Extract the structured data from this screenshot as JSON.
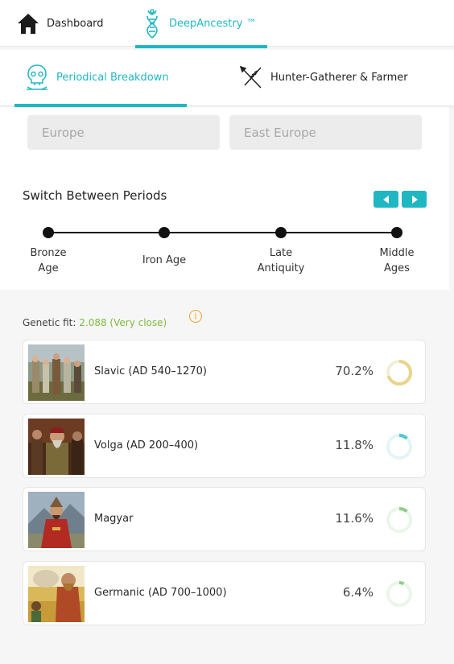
{
  "nav": {
    "dashboard": "Dashboard",
    "deep_ancestry": "DeepAncestry ™"
  },
  "subnav": {
    "periodical": "Periodical Breakdown",
    "hunter": "Hunter-Gatherer & Farmer"
  },
  "filters": {
    "region": "Europe",
    "subregion": "East Europe"
  },
  "periods": {
    "title": "Switch Between Periods",
    "labels": [
      "Bronze Age",
      "Iron Age",
      "Late Antiquity",
      "Middle Ages"
    ]
  },
  "fit": {
    "label": "Genetic fit:",
    "value": "2.088 (Very close)",
    "info_icon": "info-icon"
  },
  "results": [
    {
      "name": "Slavic (AD 540–1270)",
      "percent": "70.2%",
      "fraction": 0.702,
      "color": "#e9d48a"
    },
    {
      "name": "Volga (AD 200–400)",
      "percent": "11.8%",
      "fraction": 0.118,
      "color": "#4ec8d8"
    },
    {
      "name": "Magyar",
      "percent": "11.6%",
      "fraction": 0.116,
      "color": "#8ccf86"
    },
    {
      "name": "Germanic (AD 700–1000)",
      "percent": "6.4%",
      "fraction": 0.064,
      "color": "#8ccf86"
    }
  ],
  "colors": {
    "accent": "#20b7c3",
    "fit_value": "#7cbb3f",
    "info": "#f2a21b"
  }
}
